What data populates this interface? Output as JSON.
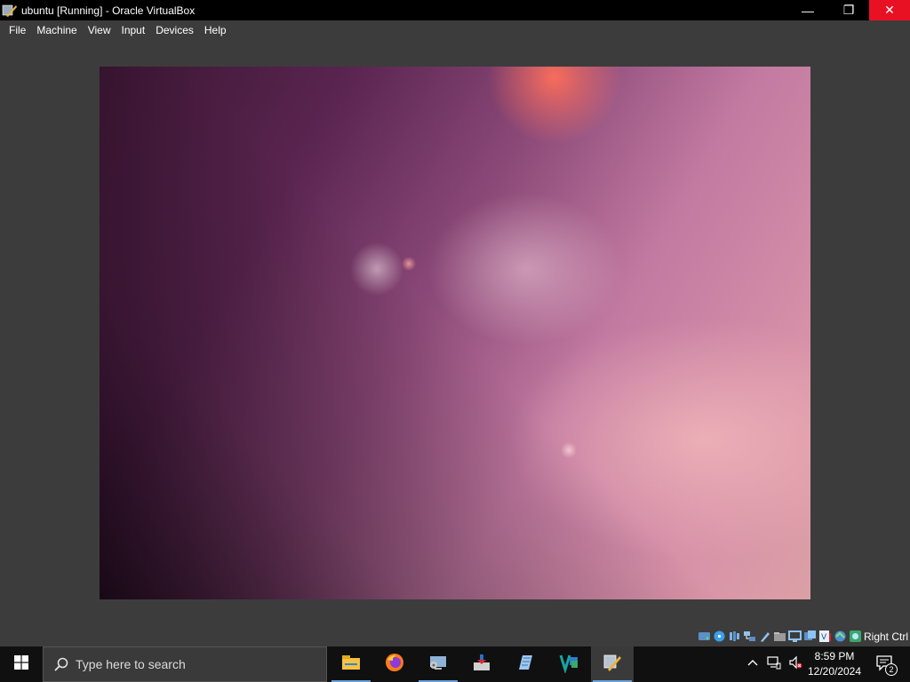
{
  "window": {
    "title": "ubuntu [Running] - Oracle VirtualBox",
    "minimize_glyph": "—",
    "restore_glyph": "❐",
    "close_glyph": "✕"
  },
  "menu": {
    "items": [
      "File",
      "Machine",
      "View",
      "Input",
      "Devices",
      "Help"
    ]
  },
  "statusbar": {
    "host_key": "Right Ctrl",
    "icons": [
      "hard-disk-icon",
      "optical-drive-icon",
      "audio-icon",
      "network-icon",
      "usb-icon",
      "shared-folders-icon",
      "display-icon",
      "recording-icon",
      "vt-x-icon",
      "capture-icon",
      "mouse-integration-icon"
    ]
  },
  "taskbar": {
    "search_placeholder": "Type here to search",
    "apps": [
      "file-explorer-icon",
      "firefox-icon",
      "control-panel-icon",
      "installer-icon",
      "notepad-icon",
      "vs-code-icon",
      "virtualbox-icon"
    ],
    "clock_time": "8:59 PM",
    "clock_date": "12/20/2024",
    "notification_count": "2"
  },
  "colors": {
    "chrome": "#3c3c3c",
    "close_red": "#e81123",
    "taskbar": "#101010"
  }
}
